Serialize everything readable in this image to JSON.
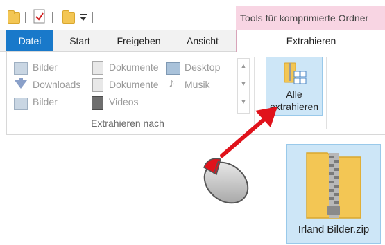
{
  "quick_access": {
    "items": [
      "folder-icon",
      "properties-icon",
      "new-folder-icon",
      "customize-dropdown-icon"
    ]
  },
  "contextual_tab": {
    "title": "Tools für komprimierte Ordner",
    "color": "#f8d5e3"
  },
  "tabs": [
    {
      "label": "Datei"
    },
    {
      "label": "Start"
    },
    {
      "label": "Freigeben"
    },
    {
      "label": "Ansicht"
    },
    {
      "label": "Extrahieren"
    }
  ],
  "ribbon": {
    "group_label": "Extrahieren nach",
    "destinations": [
      {
        "label": "Bilder",
        "icon": "pictures-icon"
      },
      {
        "label": "Downloads",
        "icon": "downloads-icon"
      },
      {
        "label": "Bilder",
        "icon": "pictures-icon"
      },
      {
        "label": "Dokumente",
        "icon": "documents-icon"
      },
      {
        "label": "Dokumente",
        "icon": "documents-icon"
      },
      {
        "label": "Videos",
        "icon": "videos-icon"
      },
      {
        "label": "Desktop",
        "icon": "desktop-icon"
      },
      {
        "label": "Musik",
        "icon": "music-icon"
      }
    ],
    "extract_all": {
      "line1": "Alle",
      "line2": "extrahieren"
    }
  },
  "file": {
    "name": "Irland Bilder.zip",
    "icon": "zip-folder-icon"
  },
  "colors": {
    "accent": "#1979ca",
    "selection": "#cde6f7",
    "arrow": "#e0121b"
  }
}
